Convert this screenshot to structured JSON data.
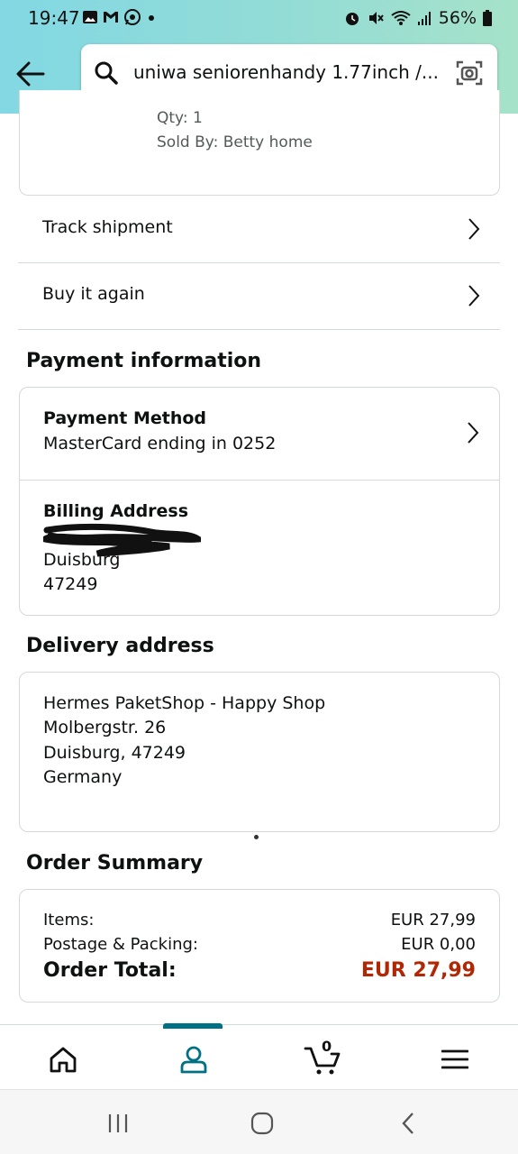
{
  "status_bar": {
    "time": "19:47",
    "left_icons": [
      "image-icon",
      "gmail-icon",
      "whatsapp-icon",
      "dot"
    ],
    "right_icons": [
      "alarm-icon",
      "mute-icon",
      "wifi-icon",
      "signal-icon"
    ],
    "battery": "56%"
  },
  "header": {
    "search_text": "uniwa seniorenhandy 1.77inch /..."
  },
  "order_item": {
    "qty": "Qty: 1",
    "sold_by": "Sold By: Betty home"
  },
  "actions": [
    {
      "label": "Track shipment"
    },
    {
      "label": "Buy it again"
    }
  ],
  "payment": {
    "heading": "Payment information",
    "method_title": "Payment Method",
    "method_value": "MasterCard ending in 0252",
    "billing_title": "Billing Address",
    "billing_city": "Duisburg",
    "billing_zip": "47249"
  },
  "delivery": {
    "heading": "Delivery address",
    "lines": [
      "Hermes PaketShop - Happy Shop",
      "Molbergstr. 26",
      "Duisburg, 47249",
      "Germany"
    ]
  },
  "summary": {
    "heading": "Order Summary",
    "items_label": "Items:",
    "items_value": "EUR 27,99",
    "postage_label": "Postage & Packing:",
    "postage_value": "EUR 0,00",
    "total_label": "Order Total:",
    "total_value": "EUR 27,99",
    "total_color": "#b12704"
  },
  "bottom_nav": {
    "items": [
      "home-icon",
      "account-icon",
      "cart-icon",
      "menu-icon"
    ],
    "active": "account-icon",
    "cart_count": "0",
    "accent": "#007185"
  },
  "system_nav": [
    "recent-apps-icon",
    "home-button-icon",
    "back-button-icon"
  ]
}
